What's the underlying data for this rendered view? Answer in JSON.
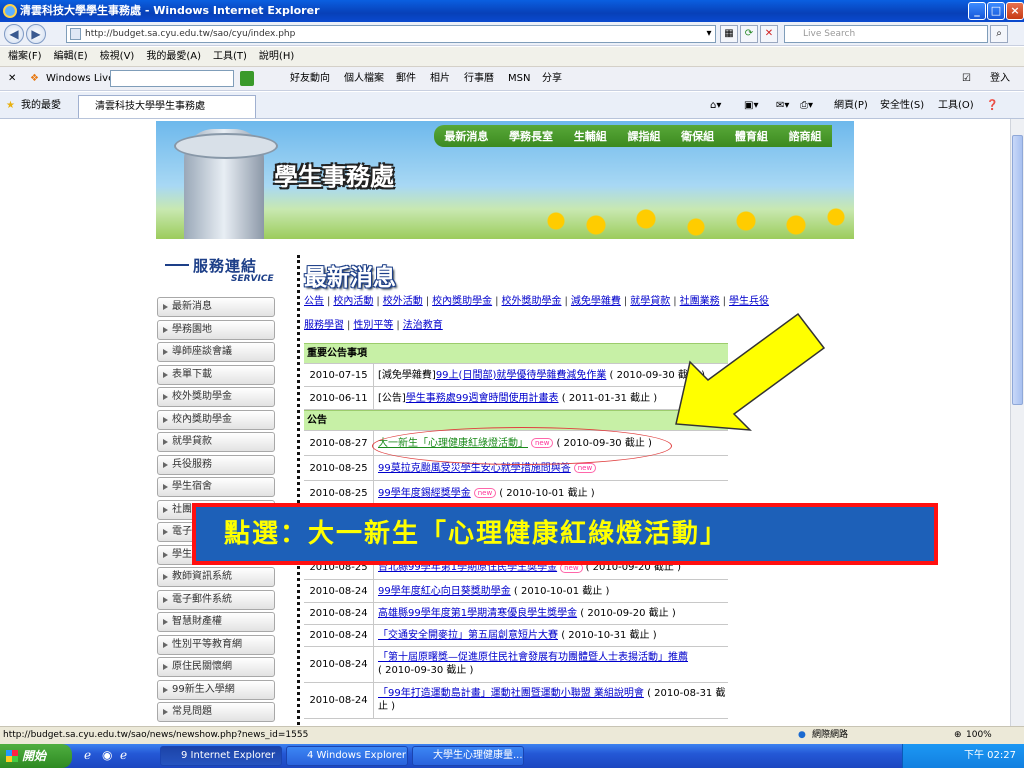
{
  "window": {
    "title": "清雲科技大學學生事務處 - Windows Internet Explorer"
  },
  "address": {
    "url": "http://budget.sa.cyu.edu.tw/sao/cyu/index.php",
    "search_placeholder": "Live Search"
  },
  "menu": [
    "檔案(F)",
    "編輯(E)",
    "檢視(V)",
    "我的最愛(A)",
    "工具(T)",
    "說明(H)"
  ],
  "livebar": {
    "brand": "Windows Live",
    "items": [
      "好友動向",
      "個人檔案",
      "郵件",
      "相片",
      "行事曆",
      "MSN",
      "分享"
    ],
    "signin": "登入"
  },
  "favbar": {
    "favorites": "我的最愛",
    "tab": "清雲科技大學學生事務處",
    "tools": [
      "網頁(P)",
      "安全性(S)",
      "工具(O)"
    ]
  },
  "banner": {
    "title": "學生事務處",
    "nav": [
      "最新消息",
      "學務長室",
      "生輔組",
      "課指組",
      "衛保組",
      "體育組",
      "諮商組"
    ]
  },
  "service": {
    "zh": "服務連結",
    "en": "SERVICE"
  },
  "sidenav": [
    "最新消息",
    "學務園地",
    "導師座談會議",
    "表單下載",
    "校外獎助學金",
    "校內獎助學金",
    "就學貸款",
    "兵役服務",
    "學生宿舍",
    "社團活動",
    "電子報",
    "學生手冊",
    "教師資訊系統",
    "電子郵件系統",
    "智慧財產權",
    "性別平等教育網",
    "原住民關懷網",
    "99新生入學網",
    "常見問題"
  ],
  "news": {
    "heading": "最新消息",
    "categories_row1": [
      "公告",
      "校內活動",
      "校外活動",
      "校內獎助學金",
      "校外獎助學金",
      "減免學雜費",
      "就學貸款",
      "社團業務",
      "學生兵役"
    ],
    "categories_row2": [
      "服務學習",
      "性別平等",
      "法治教育"
    ],
    "important_header": "重要公告事項",
    "important": [
      {
        "date": "2010-07-15",
        "prefix": "[減免學雜費]",
        "title": "99上(日間部)就學優待學雜費減免作業",
        "suffix": "( 2010-09-30 截止 )"
      },
      {
        "date": "2010-06-11",
        "prefix": "[公告]",
        "title": "學生事務處99週會時間使用計畫表",
        "suffix": "( 2011-01-31 截止 )"
      }
    ],
    "notice_header": "公告",
    "notices": [
      {
        "date": "2010-08-27",
        "title": "大一新生「心理健康紅綠燈活動」",
        "suffix": "( 2010-09-30 截止 )",
        "new": true
      },
      {
        "date": "2010-08-25",
        "title": "99莫拉克颱風受災學生安心就學措施問與答",
        "suffix": "",
        "new": true
      },
      {
        "date": "2010-08-25",
        "title": "99學年度錫經獎學金",
        "suffix": "( 2010-10-01 截止 )",
        "new": true
      },
      {
        "date": "2010-08-25",
        "title": "台北縣99學年第1學期原住民學生獎學金",
        "suffix": "( 2010-09-20 截止 )",
        "new": true
      },
      {
        "date": "2010-08-24",
        "title": "99學年度紅心向日葵獎助學金",
        "suffix": "( 2010-10-01 截止 )",
        "new": false
      },
      {
        "date": "2010-08-24",
        "title": "高雄縣99學年度第1學期清寒優良學生獎學金",
        "suffix": "( 2010-09-20 截止 )",
        "new": false
      },
      {
        "date": "2010-08-24",
        "title": "「交通安全開麥拉」第五屆創意短片大賽",
        "suffix": "( 2010-10-31 截止 )",
        "new": false
      },
      {
        "date": "2010-08-24",
        "title": "「第十屆原曙獎—促進原住民社會發展有功團體暨人士表揚活動」推薦",
        "suffix": "( 2010-09-30 截止 )",
        "new": false
      },
      {
        "date": "2010-08-24",
        "title": "「99年打造運動島計畫」運動社團暨運動小聯盟 業組說明會",
        "suffix": "( 2010-08-31 截止 )",
        "new": false
      }
    ]
  },
  "callout": "點選：大一新生「心理健康紅綠燈活動」",
  "status": {
    "url": "http://budget.sa.cyu.edu.tw/sao/news/newshow.php?news_id=1555",
    "zone": "網際網路",
    "zoom": "100%"
  },
  "taskbar": {
    "start": "開始",
    "tasks": [
      "9 Internet Explorer",
      "4 Windows Explorer",
      "大學生心理健康量..."
    ],
    "time": "下午 02:27"
  },
  "colors": {
    "callout_bg": "#1d60b8",
    "callout_text": "#ffff00",
    "callout_border": "#ff1010",
    "section_green": "#c7f0a6"
  }
}
